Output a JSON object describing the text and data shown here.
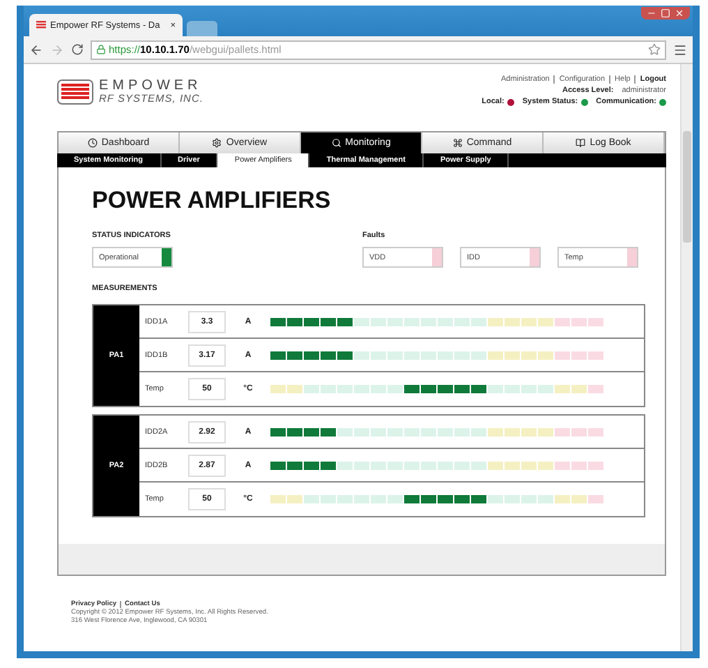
{
  "browser": {
    "tab_title": "Empower RF Systems - Da",
    "tab_close": "×",
    "url_scheme": "https://",
    "url_host": "10.10.1.70",
    "url_path": "/webgui/pallets.html"
  },
  "header": {
    "logo_line1": "EMPOWER",
    "logo_line2": "RF SYSTEMS, INC.",
    "links": [
      "Administration",
      "Configuration",
      "Help",
      "Logout"
    ],
    "access_label": "Access Level:",
    "access_value": "administrator",
    "indicators": [
      {
        "label": "Local:",
        "color": "#b0103a"
      },
      {
        "label": "System Status:",
        "color": "#1a9a4a"
      },
      {
        "label": "Communication:",
        "color": "#1a9a4a"
      }
    ]
  },
  "nav_tabs": [
    {
      "label": "Dashboard",
      "selected": false
    },
    {
      "label": "Overview",
      "selected": false
    },
    {
      "label": "Monitoring",
      "selected": true
    },
    {
      "label": "Command",
      "selected": false
    },
    {
      "label": "Log Book",
      "selected": false
    }
  ],
  "sub_tabs": [
    {
      "label": "System Monitoring",
      "selected": false
    },
    {
      "label": "Driver",
      "selected": false
    },
    {
      "label": "Power Amplifiers",
      "selected": true
    },
    {
      "label": "Thermal Management",
      "selected": false
    },
    {
      "label": "Power Supply",
      "selected": false
    }
  ],
  "page_title": "POWER AMPLIFIERS",
  "status_heading": "STATUS INDICATORS",
  "status": [
    {
      "label": "Operational",
      "color": "#158a3e"
    }
  ],
  "faults_heading": "Faults",
  "faults": [
    {
      "label": "VDD",
      "color": "#f6cfd8"
    },
    {
      "label": "IDD",
      "color": "#f6cfd8"
    },
    {
      "label": "Temp",
      "color": "#f6cfd8"
    }
  ],
  "measurements_heading": "MEASUREMENTS",
  "groups": [
    {
      "name": "PA1",
      "rows": [
        {
          "label": "IDD1A",
          "value": "3.3",
          "unit": "A",
          "kind": "bar",
          "level": 0.25
        },
        {
          "label": "IDD1B",
          "value": "3.17",
          "unit": "A",
          "kind": "bar",
          "level": 0.25
        },
        {
          "label": "Temp",
          "value": "50",
          "unit": "°C",
          "kind": "band",
          "level": 0.525
        }
      ]
    },
    {
      "name": "PA2",
      "rows": [
        {
          "label": "IDD2A",
          "value": "2.92",
          "unit": "A",
          "kind": "bar",
          "level": 0.2
        },
        {
          "label": "IDD2B",
          "value": "2.87",
          "unit": "A",
          "kind": "bar",
          "level": 0.2
        },
        {
          "label": "Temp",
          "value": "50",
          "unit": "°C",
          "kind": "band",
          "level": 0.525
        }
      ]
    }
  ],
  "footer": {
    "links": [
      "Privacy Policy",
      "Contact Us"
    ],
    "copyright": "Copyright © 2012 Empower RF Systems, Inc. All Rights Reserved.",
    "address": "316 West Florence Ave, Inglewood, CA 90301"
  }
}
